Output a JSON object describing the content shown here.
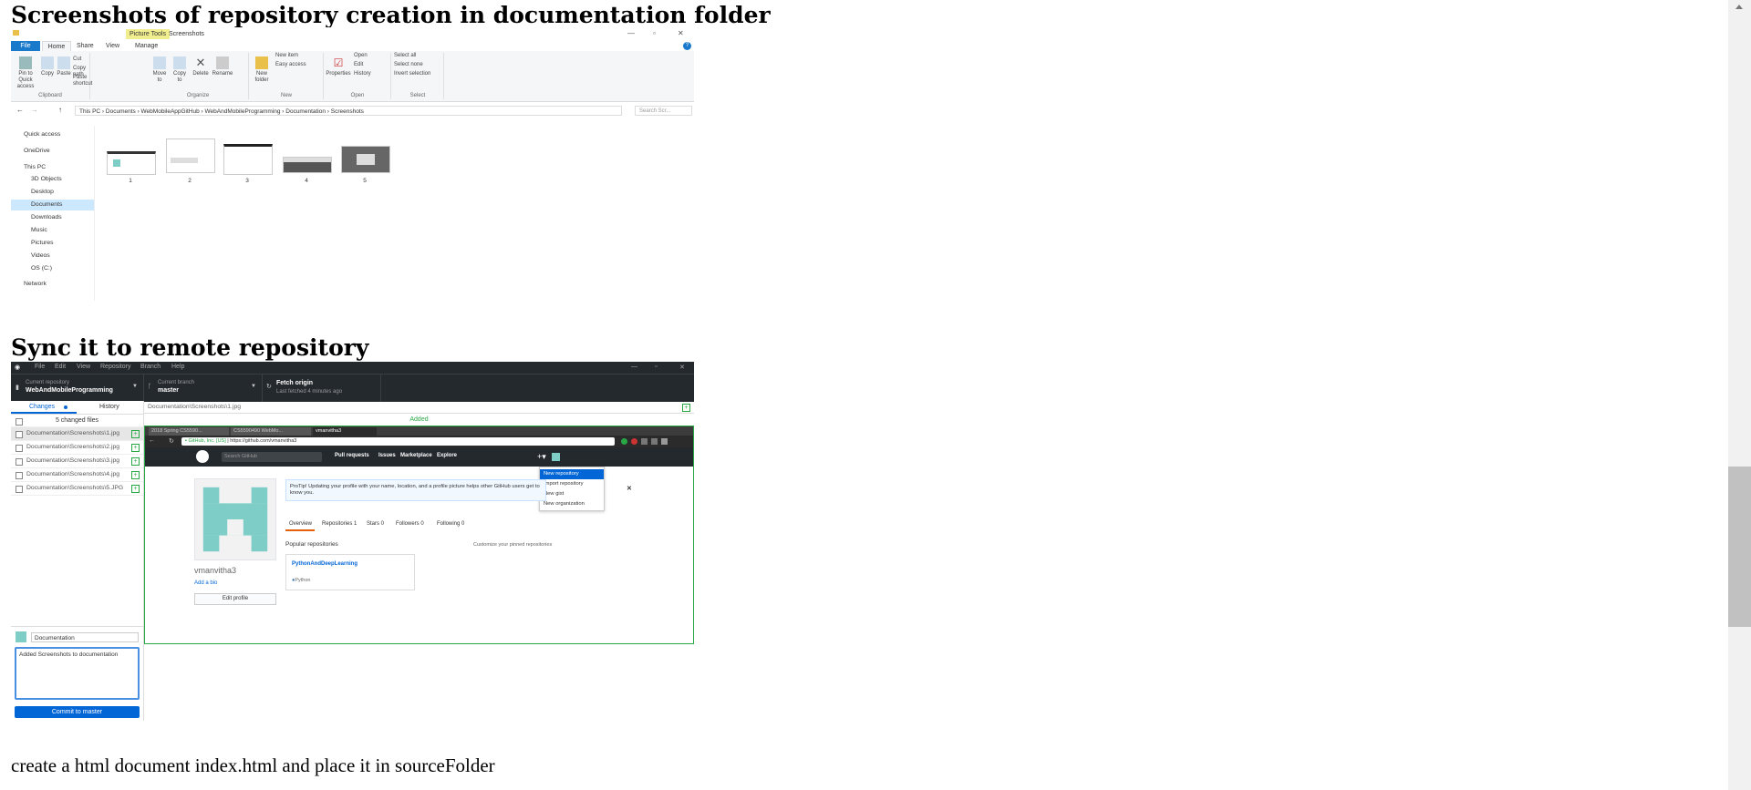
{
  "headings": {
    "section1": "Screenshots of repository creation in documentation folder",
    "section2": "Sync it to remote repository"
  },
  "paragraph": "create a html document index.html and place it in sourceFolder",
  "explorer": {
    "contextual_tab": "Picture Tools",
    "window_title": "Screenshots",
    "ribbon_tabs": [
      "File",
      "Home",
      "Share",
      "View",
      "Manage"
    ],
    "groups": {
      "clipboard": {
        "label": "Clipboard",
        "pin": "Pin to Quick access",
        "copy": "Copy",
        "paste": "Paste",
        "cut": "Cut",
        "copy_path": "Copy path",
        "paste_shortcut": "Paste shortcut"
      },
      "organize": {
        "label": "Organize",
        "move_to": "Move to",
        "copy_to": "Copy to",
        "delete": "Delete",
        "rename": "Rename"
      },
      "new": {
        "label": "New",
        "new_folder": "New folder",
        "new_item": "New item",
        "easy_access": "Easy access"
      },
      "open": {
        "label": "Open",
        "properties": "Properties",
        "open": "Open",
        "edit": "Edit",
        "history": "History"
      },
      "select": {
        "label": "Select",
        "select_all": "Select all",
        "select_none": "Select none",
        "invert": "Invert selection"
      }
    },
    "address_path": "This PC  ›  Documents  ›  WebMobileAppGitHub  ›  WebAndMobileProgramming  ›  Documentation  ›  Screenshots",
    "search_placeholder": "Search Scr...",
    "nav": [
      "Quick access",
      "OneDrive",
      "This PC",
      "3D Objects",
      "Desktop",
      "Documents",
      "Downloads",
      "Music",
      "Pictures",
      "Videos",
      "OS (C:)",
      "Network"
    ],
    "thumbnails": [
      "1",
      "2",
      "3",
      "4",
      "5"
    ]
  },
  "github_desktop": {
    "menu": [
      "File",
      "Edit",
      "View",
      "Repository",
      "Branch",
      "Help"
    ],
    "current_repo_label": "Current repository",
    "current_repo": "WebAndMobileProgramming",
    "current_branch_label": "Current branch",
    "current_branch": "master",
    "fetch_label": "Fetch origin",
    "fetch_sub": "Last fetched 4 minutes ago",
    "tab_changes": "Changes",
    "tab_history": "History",
    "changed_count": "5 changed files",
    "files": [
      "Documentation\\Screenshots\\1.jpg",
      "Documentation\\Screenshots\\2.jpg",
      "Documentation\\Screenshots\\3.jpg",
      "Documentation\\Screenshots\\4.jpg",
      "Documentation\\Screenshots\\5.JPG"
    ],
    "diff_path": "Documentation\\Screenshots\\1.jpg",
    "added_label": "Added",
    "summary": "Documentation",
    "description": "Added Screenshots to documentation",
    "commit_button": "Commit to master"
  },
  "embedded_browser": {
    "tabs": [
      "2018 Spring CS5590...",
      "CS5590490 WebMo...",
      "vmanvitha3"
    ],
    "url_prefix": "GitHub, Inc. [US]",
    "url": "https://github.com/vmanvitha3",
    "search_placeholder": "Search GitHub",
    "nav": [
      "Pull requests",
      "Issues",
      "Marketplace",
      "Explore"
    ],
    "menu": [
      "New repository",
      "Import repository",
      "New gist",
      "New organization"
    ],
    "protip": "ProTip! Updating your profile with your name, location, and a profile picture helps other GitHub users get to know you.",
    "profile_tabs": [
      "Overview",
      "Repositories 1",
      "Stars 0",
      "Followers 0",
      "Following 0"
    ],
    "popular": "Popular repositories",
    "customize": "Customize your pinned repositories",
    "repo_name": "PythonAndDeepLearning",
    "repo_lang": "Python",
    "username": "vmanvitha3",
    "add_bio": "Add a bio",
    "edit_profile": "Edit profile"
  }
}
